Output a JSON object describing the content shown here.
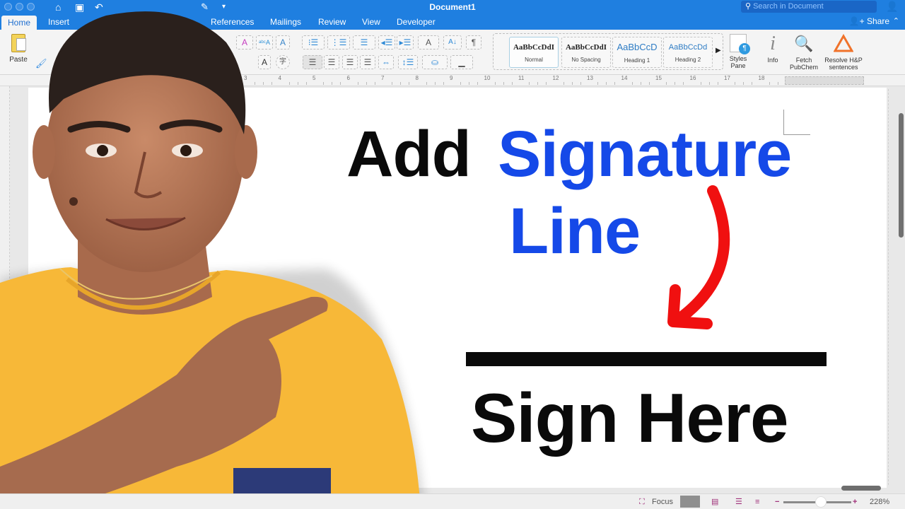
{
  "window": {
    "title": "Document1",
    "search_placeholder": "Search in Document",
    "search_icon": "magnifier-icon"
  },
  "quick_access": [
    "home-icon",
    "save-icon",
    "undo-icon",
    "redo-icon",
    "print-icon",
    "mail-icon",
    "new-doc-icon",
    "edit-icon",
    "customize-icon"
  ],
  "tabs": [
    {
      "label": "Home",
      "active": true
    },
    {
      "label": "Insert",
      "active": false
    },
    {
      "label": "References",
      "active": false
    },
    {
      "label": "Mailings",
      "active": false
    },
    {
      "label": "Review",
      "active": false
    },
    {
      "label": "View",
      "active": false
    },
    {
      "label": "Developer",
      "active": false
    }
  ],
  "share": {
    "label": "Share",
    "icon": "add-person-icon"
  },
  "ribbon": {
    "paste_label": "Paste",
    "styles": [
      {
        "sample": "AaBbCcDdI",
        "name": "Normal",
        "selected": true
      },
      {
        "sample": "AaBbCcDdI",
        "name": "No Spacing",
        "selected": false
      },
      {
        "sample": "AaBbCcD",
        "name": "Heading 1",
        "selected": false
      },
      {
        "sample": "AaBbCcDd",
        "name": "Heading 2",
        "selected": false
      }
    ],
    "styles_pane": {
      "line1": "Styles",
      "line2": "Pane"
    },
    "info": {
      "label": "Info"
    },
    "fetch": {
      "line1": "Fetch",
      "line2": "PubChem"
    },
    "resolve": {
      "line1": "Resolve H&P",
      "line2": "sentences"
    }
  },
  "ruler": {
    "numbers": [
      "3",
      "4",
      "5",
      "6",
      "7",
      "8",
      "9",
      "10",
      "11",
      "12",
      "13",
      "14",
      "15",
      "16",
      "17",
      "18"
    ]
  },
  "document": {
    "line1_black": "Add",
    "line1_blue": "Signature",
    "line2_blue": "Line",
    "signature_caption": "Sign Here"
  },
  "colors": {
    "accent_blue": "#1f7fe0",
    "headline_blue": "#1549e8",
    "arrow_red": "#f01010",
    "shirt_yellow": "#f7b838",
    "pocket_navy": "#2c3a78"
  },
  "statusbar": {
    "focus_label": "Focus",
    "zoom_level": "228%",
    "zoom_fraction": 0.55
  }
}
